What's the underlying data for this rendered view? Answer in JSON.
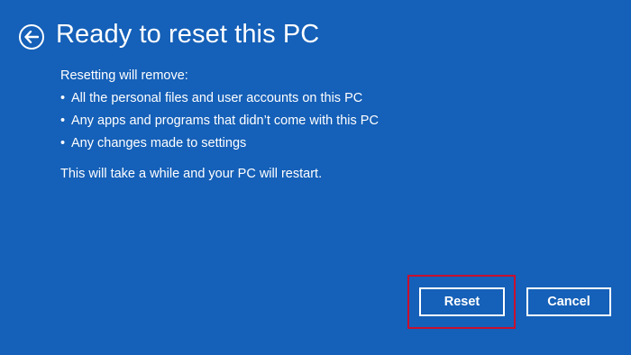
{
  "header": {
    "back_icon": "back-arrow-icon",
    "title": "Ready to reset this PC"
  },
  "content": {
    "intro": "Resetting will remove:",
    "bullet_char": "•",
    "items": [
      "All the personal files and user accounts on this PC",
      "Any apps and programs that didn’t come with this PC",
      "Any changes made to settings"
    ],
    "note": "This will take a while and your PC will restart."
  },
  "buttons": {
    "reset_label": "Reset",
    "cancel_label": "Cancel"
  },
  "colors": {
    "background": "#1560b8",
    "text": "#ffffff",
    "highlight": "#c8102e"
  }
}
